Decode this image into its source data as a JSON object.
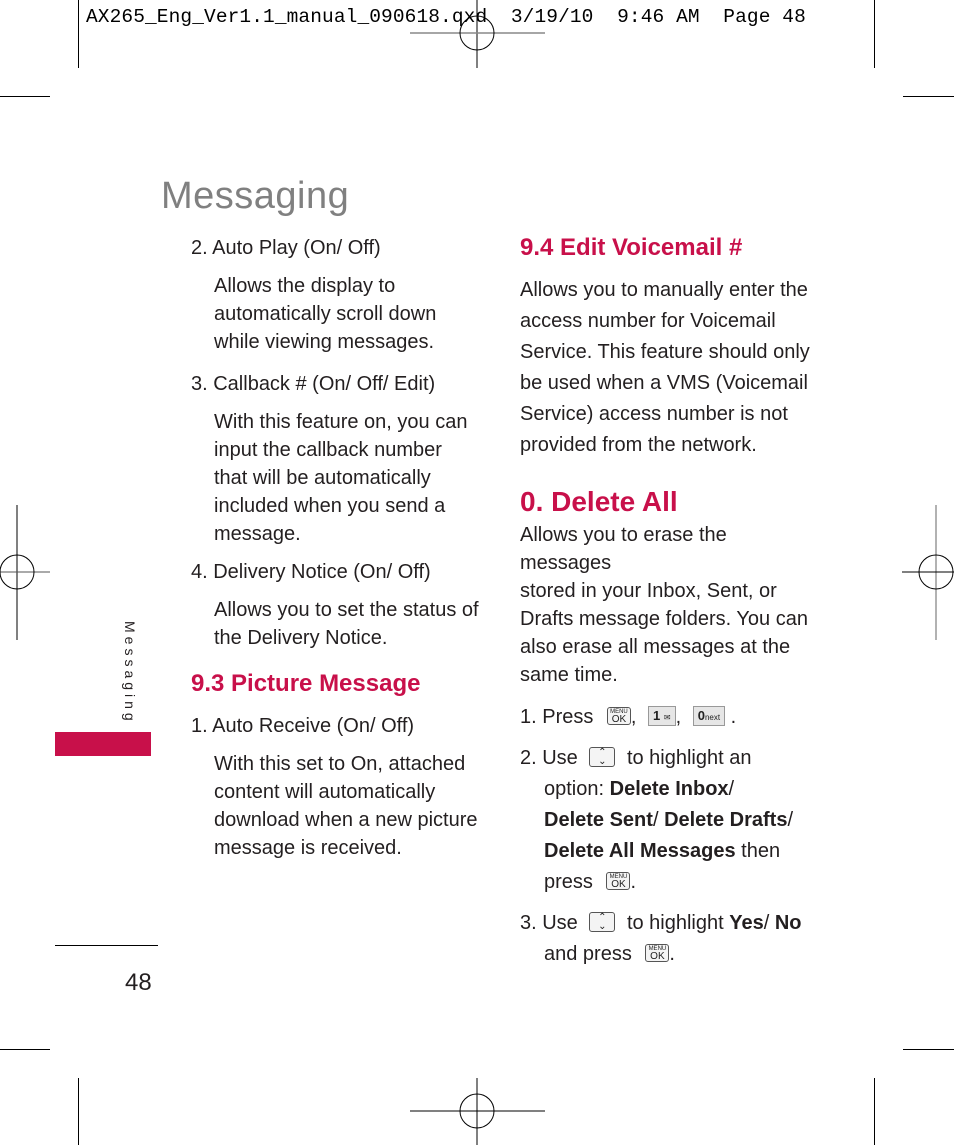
{
  "slug": {
    "text": "AX265_Eng_Ver1.1_manual_090618.qxd  3/19/10  9:46 AM  Page 48"
  },
  "header": {
    "title": "Messaging"
  },
  "sidebar": {
    "label": "Messaging",
    "tab_color": "#c8104a"
  },
  "folio": {
    "page_number": "48"
  },
  "accent_color": "#c8104a",
  "left_column": {
    "items": [
      {
        "heading": "2. Auto Play (On/ Off)",
        "body": [
          "Allows the display to",
          "automatically scroll down",
          "while viewing messages."
        ]
      },
      {
        "heading": "3. Callback # (On/ Off/ Edit)",
        "body": [
          "With this feature on, you can",
          "input the callback number",
          "that will be automatically",
          "included when you send a",
          "message."
        ]
      },
      {
        "heading": "4. Delivery Notice (On/ Off)",
        "body": [
          "Allows you to set the status of",
          "the Delivery Notice."
        ]
      }
    ],
    "section_93": {
      "heading": "9.3 Picture Message",
      "item": {
        "heading": "1. Auto Receive (On/ Off)",
        "body": [
          "With this set to On, attached",
          "content will automatically",
          "download when a new picture",
          "message is received."
        ]
      }
    }
  },
  "right_column": {
    "section_94": {
      "heading": "9.4 Edit Voicemail #",
      "body": [
        "Allows you to manually enter the",
        "access number for Voicemail",
        "Service. This feature should only",
        "be used when a VMS (Voicemail",
        "Service) access number is not",
        "provided from the network."
      ]
    },
    "section_0": {
      "heading": "0. Delete All",
      "body": [
        "Allows you to erase the messages",
        "stored in your Inbox, Sent, or",
        "Drafts message folders. You can",
        "also erase all messages at the",
        "same time."
      ],
      "steps": {
        "step1": {
          "prefix": "1. Press",
          "comma": ",",
          "end": "."
        },
        "step2": {
          "prefix": "2. Use",
          "mid": "to highlight an",
          "line2_plain": "option:",
          "opt1": "Delete Inbox",
          "sep": "/",
          "opt2": "Delete Sent",
          "opt3": "Delete Drafts",
          "opt4": "Delete All Messages",
          "then": "then",
          "press": "press",
          "end": "."
        },
        "step3": {
          "prefix": "3. Use",
          "mid": "to highlight",
          "yes": "Yes",
          "sep": "/",
          "no": "No",
          "and_press": "and press",
          "end": "."
        }
      }
    }
  },
  "keys": {
    "menu_ok_top": "MENU",
    "menu_ok_bottom": "OK",
    "one_key": "1",
    "one_key_sub": "✉",
    "zero_key": "0",
    "zero_key_sub": "next",
    "nav_up": "⌃",
    "nav_down": "⌄"
  }
}
